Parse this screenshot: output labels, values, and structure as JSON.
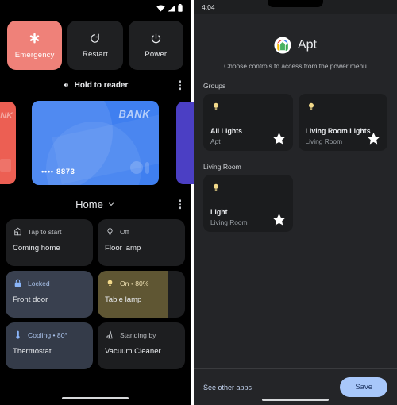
{
  "left_screen": {
    "statusbar": {
      "icons": [
        "wifi-icon",
        "signal-icon",
        "battery-icon"
      ]
    },
    "power_buttons": [
      {
        "label": "Emergency",
        "icon": "emergency-asterisk-icon",
        "accent": "#ef8179"
      },
      {
        "label": "Restart",
        "icon": "restart-icon",
        "accent": "#1f2022"
      },
      {
        "label": "Power",
        "icon": "power-icon",
        "accent": "#1f2022"
      }
    ],
    "wallet": {
      "header": "Hold to reader",
      "header_icon": "nfc-icon",
      "menu_icon": "overflow-menu-icon",
      "active_card": {
        "bank_label": "BANK",
        "number": "•••• 8873",
        "color": "#3f7ff0"
      },
      "left_card": {
        "bank_label": "NK",
        "color": "#ec5f53"
      },
      "right_card": {
        "color": "#4b3fc4"
      }
    },
    "home": {
      "title": "Home",
      "chevron_icon": "chevron-down-icon",
      "menu_icon": "overflow-menu-icon",
      "tiles": [
        {
          "status": "Tap to start",
          "name": "Coming home",
          "icon": "routine-icon",
          "state": "off"
        },
        {
          "status": "Off",
          "name": "Floor lamp",
          "icon": "bulb-outline-icon",
          "state": "off"
        },
        {
          "status": "Locked",
          "name": "Front door",
          "icon": "lock-icon",
          "state": "locked"
        },
        {
          "status": "On • 80%",
          "name": "Table lamp",
          "icon": "bulb-filled-icon",
          "state": "on",
          "fill_percent": 80
        },
        {
          "status": "Cooling • 80°",
          "name": "Thermostat",
          "icon": "thermostat-icon",
          "state": "cooling"
        },
        {
          "status": "Standing by",
          "name": "Vacuum Cleaner",
          "icon": "vacuum-icon",
          "state": "off"
        }
      ]
    }
  },
  "right_screen": {
    "statusbar": {
      "time": "4:04"
    },
    "app": {
      "name": "Apt",
      "logo_icon": "google-home-icon",
      "subtitle": "Choose controls to access from the power menu"
    },
    "sections": [
      {
        "title": "Groups",
        "controls": [
          {
            "name": "All Lights",
            "location": "Apt",
            "icon": "bulb-filled-icon",
            "star_icon": "star-filled-icon",
            "selected": true
          },
          {
            "name": "Living Room Lights",
            "location": "Living Room",
            "icon": "bulb-filled-icon",
            "star_icon": "star-filled-icon",
            "selected": true
          }
        ]
      },
      {
        "title": "Living Room",
        "controls": [
          {
            "name": "Light",
            "location": "Living Room",
            "icon": "bulb-filled-icon",
            "star_icon": "star-filled-icon",
            "selected": true
          }
        ]
      }
    ],
    "footer": {
      "see_other_apps": "See other apps",
      "save_label": "Save",
      "save_color": "#a8c7fa"
    }
  }
}
